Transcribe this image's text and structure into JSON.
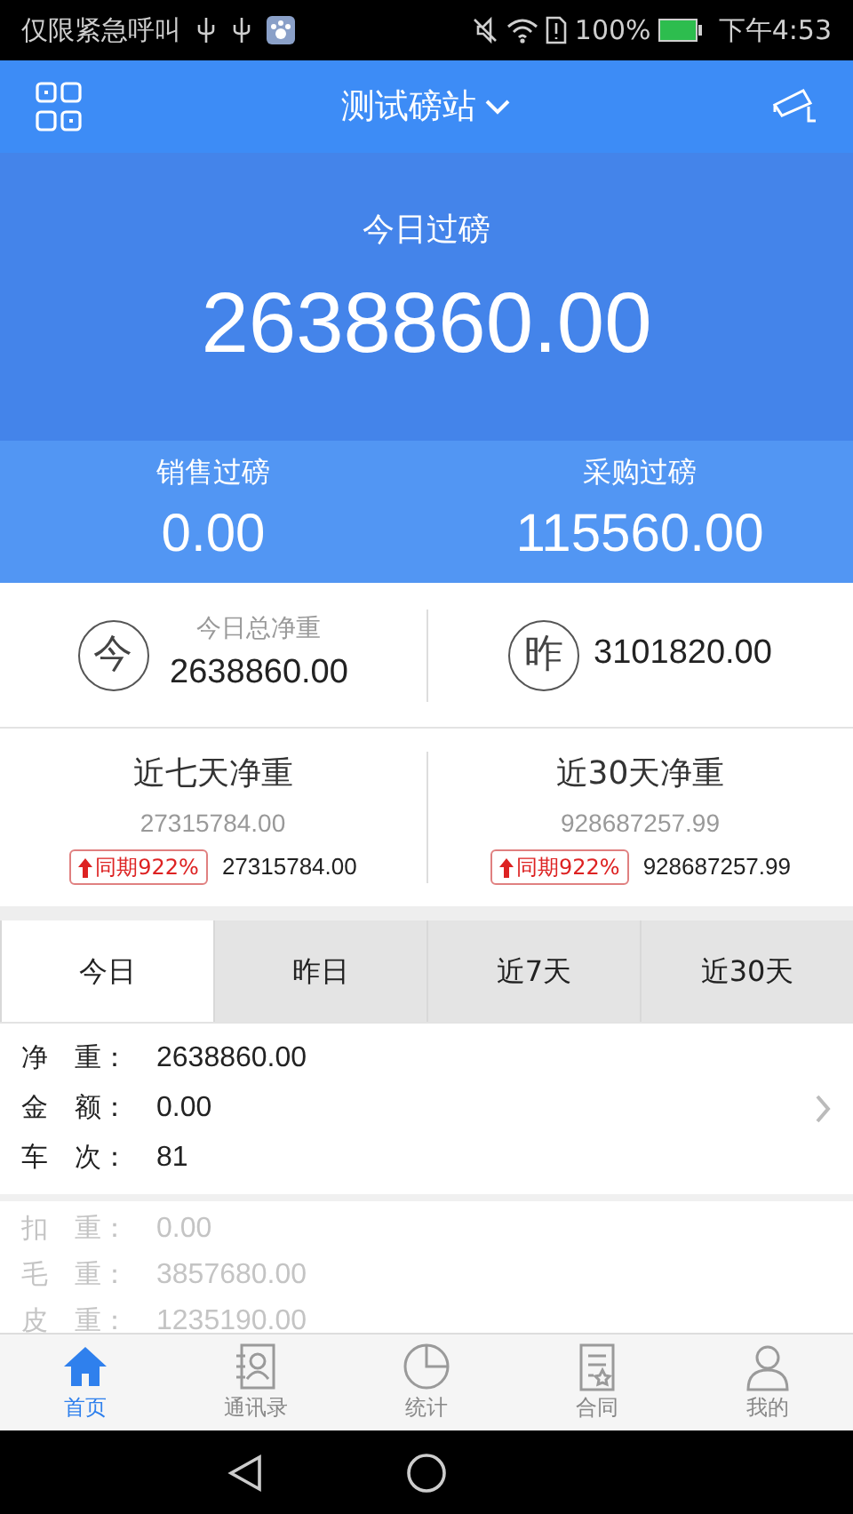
{
  "status_bar": {
    "carrier": "仅限紧急呼叫",
    "battery": "100%",
    "time": "下午4:53"
  },
  "header": {
    "title": "测试磅站"
  },
  "today_total": {
    "label": "今日过磅",
    "value": "2638860.00"
  },
  "split": [
    {
      "label": "销售过磅",
      "value": "0.00"
    },
    {
      "label": "采购过磅",
      "value": "115560.00"
    }
  ],
  "summary": {
    "today": {
      "badge": "今",
      "label": "今日总净重",
      "value": "2638860.00"
    },
    "yesterday": {
      "badge": "昨",
      "value": "3101820.00"
    }
  },
  "ranges": [
    {
      "title": "近七天净重",
      "value": "27315784.00",
      "change": "同期922%",
      "compare": "27315784.00"
    },
    {
      "title": "近30天净重",
      "value": "928687257.99",
      "change": "同期922%",
      "compare": "928687257.99"
    }
  ],
  "tabs": [
    {
      "label": "今日",
      "selected": true
    },
    {
      "label": "昨日",
      "selected": false
    },
    {
      "label": "近7天",
      "selected": false
    },
    {
      "label": "近30天",
      "selected": false
    }
  ],
  "details": {
    "primary": [
      {
        "label": "净　重：",
        "value": "2638860.00"
      },
      {
        "label": "金　额：",
        "value": "0.00"
      },
      {
        "label": "车　次：",
        "value": "81"
      }
    ],
    "secondary": [
      {
        "label": "扣　重：",
        "value": "0.00"
      },
      {
        "label": "毛　重：",
        "value": "3857680.00"
      },
      {
        "label": "皮　重：",
        "value": "1235190.00"
      }
    ]
  },
  "nav": [
    {
      "label": "首页",
      "selected": true
    },
    {
      "label": "通讯录",
      "selected": false
    },
    {
      "label": "统计",
      "selected": false
    },
    {
      "label": "合同",
      "selected": false
    },
    {
      "label": "我的",
      "selected": false
    }
  ]
}
